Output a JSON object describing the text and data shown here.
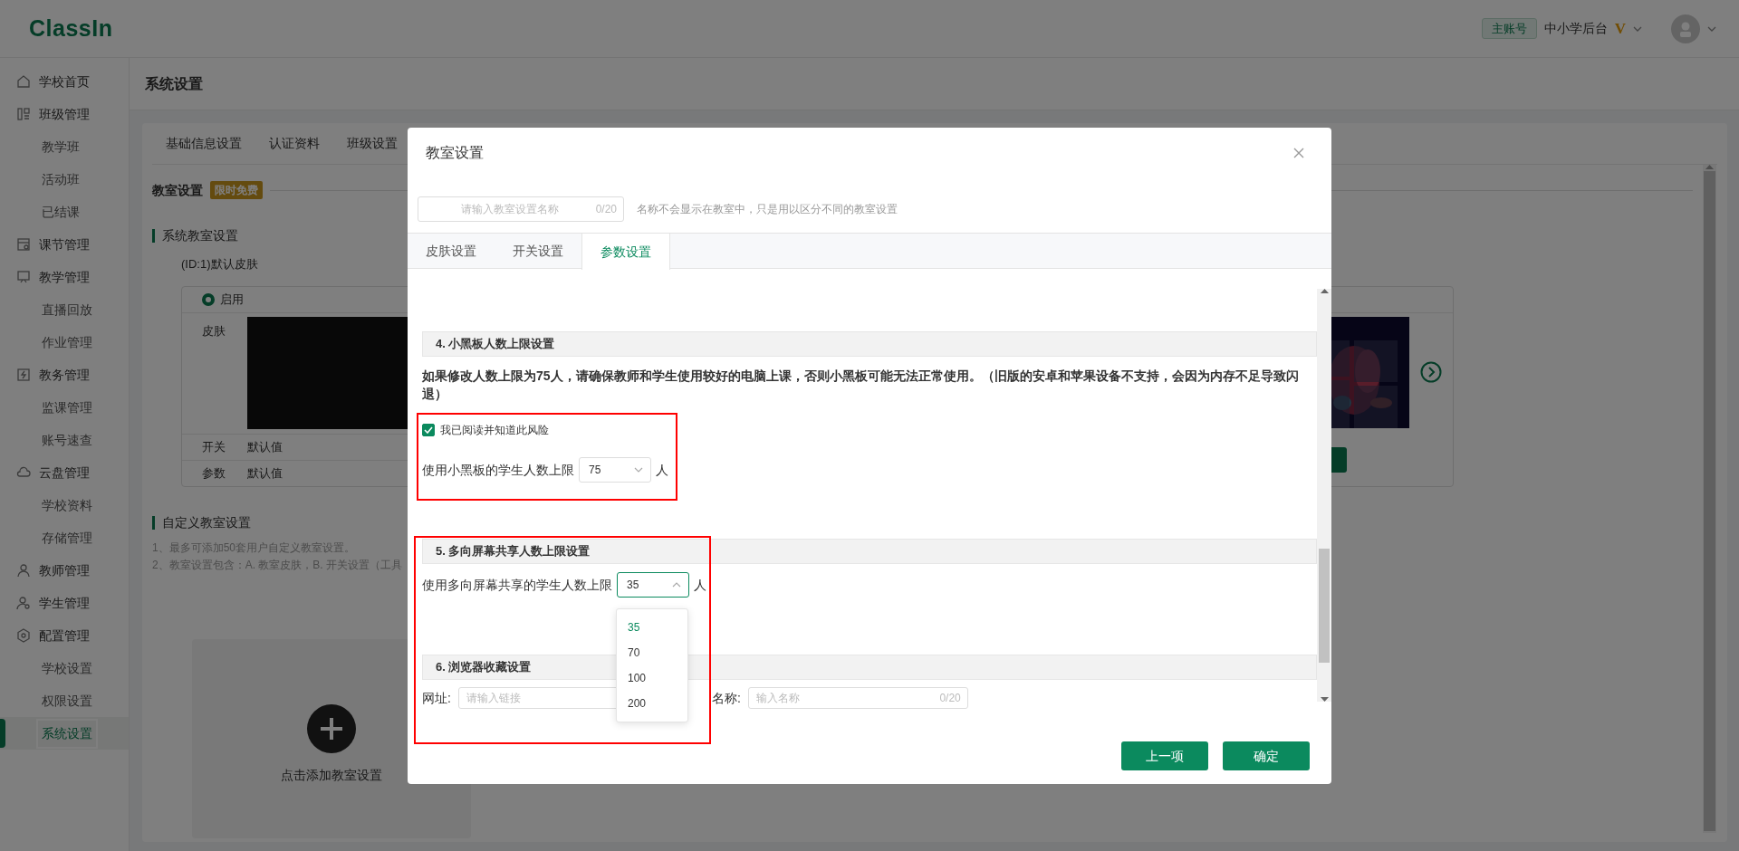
{
  "header": {
    "logo": "ClassIn",
    "account_badge": "主账号",
    "school": "中小学后台",
    "vip_mark": "V"
  },
  "sidebar": {
    "items": [
      {
        "label": "学校首页",
        "selected": false
      },
      {
        "label": "班级管理",
        "selected": false,
        "children": [
          {
            "label": "教学班",
            "selected": false
          },
          {
            "label": "活动班",
            "selected": false
          },
          {
            "label": "已结课",
            "selected": false
          }
        ]
      },
      {
        "label": "课节管理",
        "selected": false
      },
      {
        "label": "教学管理",
        "selected": false,
        "children": [
          {
            "label": "直播回放",
            "selected": false
          },
          {
            "label": "作业管理",
            "selected": false
          }
        ]
      },
      {
        "label": "教务管理",
        "selected": false,
        "children": [
          {
            "label": "监课管理",
            "selected": false
          },
          {
            "label": "账号速查",
            "selected": false
          }
        ]
      },
      {
        "label": "云盘管理",
        "selected": false,
        "children": [
          {
            "label": "学校资料",
            "selected": false
          },
          {
            "label": "存储管理",
            "selected": false
          }
        ]
      },
      {
        "label": "教师管理",
        "selected": false
      },
      {
        "label": "学生管理",
        "selected": false
      },
      {
        "label": "配置管理",
        "selected": false,
        "children": [
          {
            "label": "学校设置",
            "selected": false
          },
          {
            "label": "权限设置",
            "selected": false
          },
          {
            "label": "系统设置",
            "selected": true
          }
        ]
      }
    ]
  },
  "page": {
    "title": "系统设置",
    "tabs": [
      {
        "label": "基础信息设置",
        "selected": false
      },
      {
        "label": "认证资料",
        "selected": false
      },
      {
        "label": "班级设置",
        "selected": false
      }
    ]
  },
  "classroom": {
    "title": "教室设置",
    "badge": "限时免费",
    "system": {
      "title": "系统教室设置",
      "skin_name": "(ID:1)默认皮肤",
      "enabled": {
        "label": "启用",
        "selected": true
      },
      "rows": [
        {
          "label": "皮肤",
          "kind": "skin"
        },
        {
          "label": "开关",
          "kind": "text",
          "value": "默认值"
        },
        {
          "label": "参数",
          "kind": "text",
          "value": "默认值"
        }
      ]
    },
    "custom": {
      "title": "自定义教室设置",
      "notes": [
        "1、最多可添加50套用户自定义教室设置。",
        "2、教室设置包含：A. 教室皮肤，B. 开关设置（工具"
      ],
      "add_label": "点击添加教室设置"
    }
  },
  "modal": {
    "title": "教室设置",
    "name_field": {
      "placeholder": "请输入教室设置名称",
      "counter": "0/20"
    },
    "hint": "名称不会显示在教室中，只是用以区分不同的教室设置",
    "tabs": [
      {
        "label": "皮肤设置",
        "selected": false
      },
      {
        "label": "开关设置",
        "selected": false
      },
      {
        "label": "参数设置",
        "selected": true
      }
    ],
    "sections": [
      {
        "kind": "limit",
        "title": "4. 小黑板人数上限设置",
        "highlighted": true,
        "warning": "如果修改人数上限为75人，请确保教师和学生使用较好的电脑上课，否则小黑板可能无法正常使用。（旧版的安卓和苹果设备不支持，会因为内存不足导致闪退）",
        "checkbox": {
          "label": "我已阅读并知道此风险",
          "checked": true
        },
        "field": {
          "label": "使用小黑板的学生人数上限",
          "value": "75",
          "unit": "人",
          "expanded": false
        }
      },
      {
        "kind": "limit",
        "title": "5. 多向屏幕共享人数上限设置",
        "highlighted": true,
        "field": {
          "label": "使用多向屏幕共享的学生人数上限",
          "value": "35",
          "unit": "人",
          "expanded": true,
          "options": [
            {
              "label": "35",
              "selected": true
            },
            {
              "label": "70",
              "selected": false
            },
            {
              "label": "100",
              "selected": false
            },
            {
              "label": "200",
              "selected": false
            }
          ]
        }
      },
      {
        "kind": "bookmarks",
        "title": "6. 浏览器收藏设置",
        "inputs": [
          {
            "label": "网址:",
            "placeholder": "请输入链接"
          },
          {
            "label": "名称:",
            "placeholder": "输入名称",
            "counter": "0/20"
          }
        ]
      }
    ],
    "buttons": [
      {
        "label": "上一项"
      },
      {
        "label": "确定"
      }
    ]
  }
}
